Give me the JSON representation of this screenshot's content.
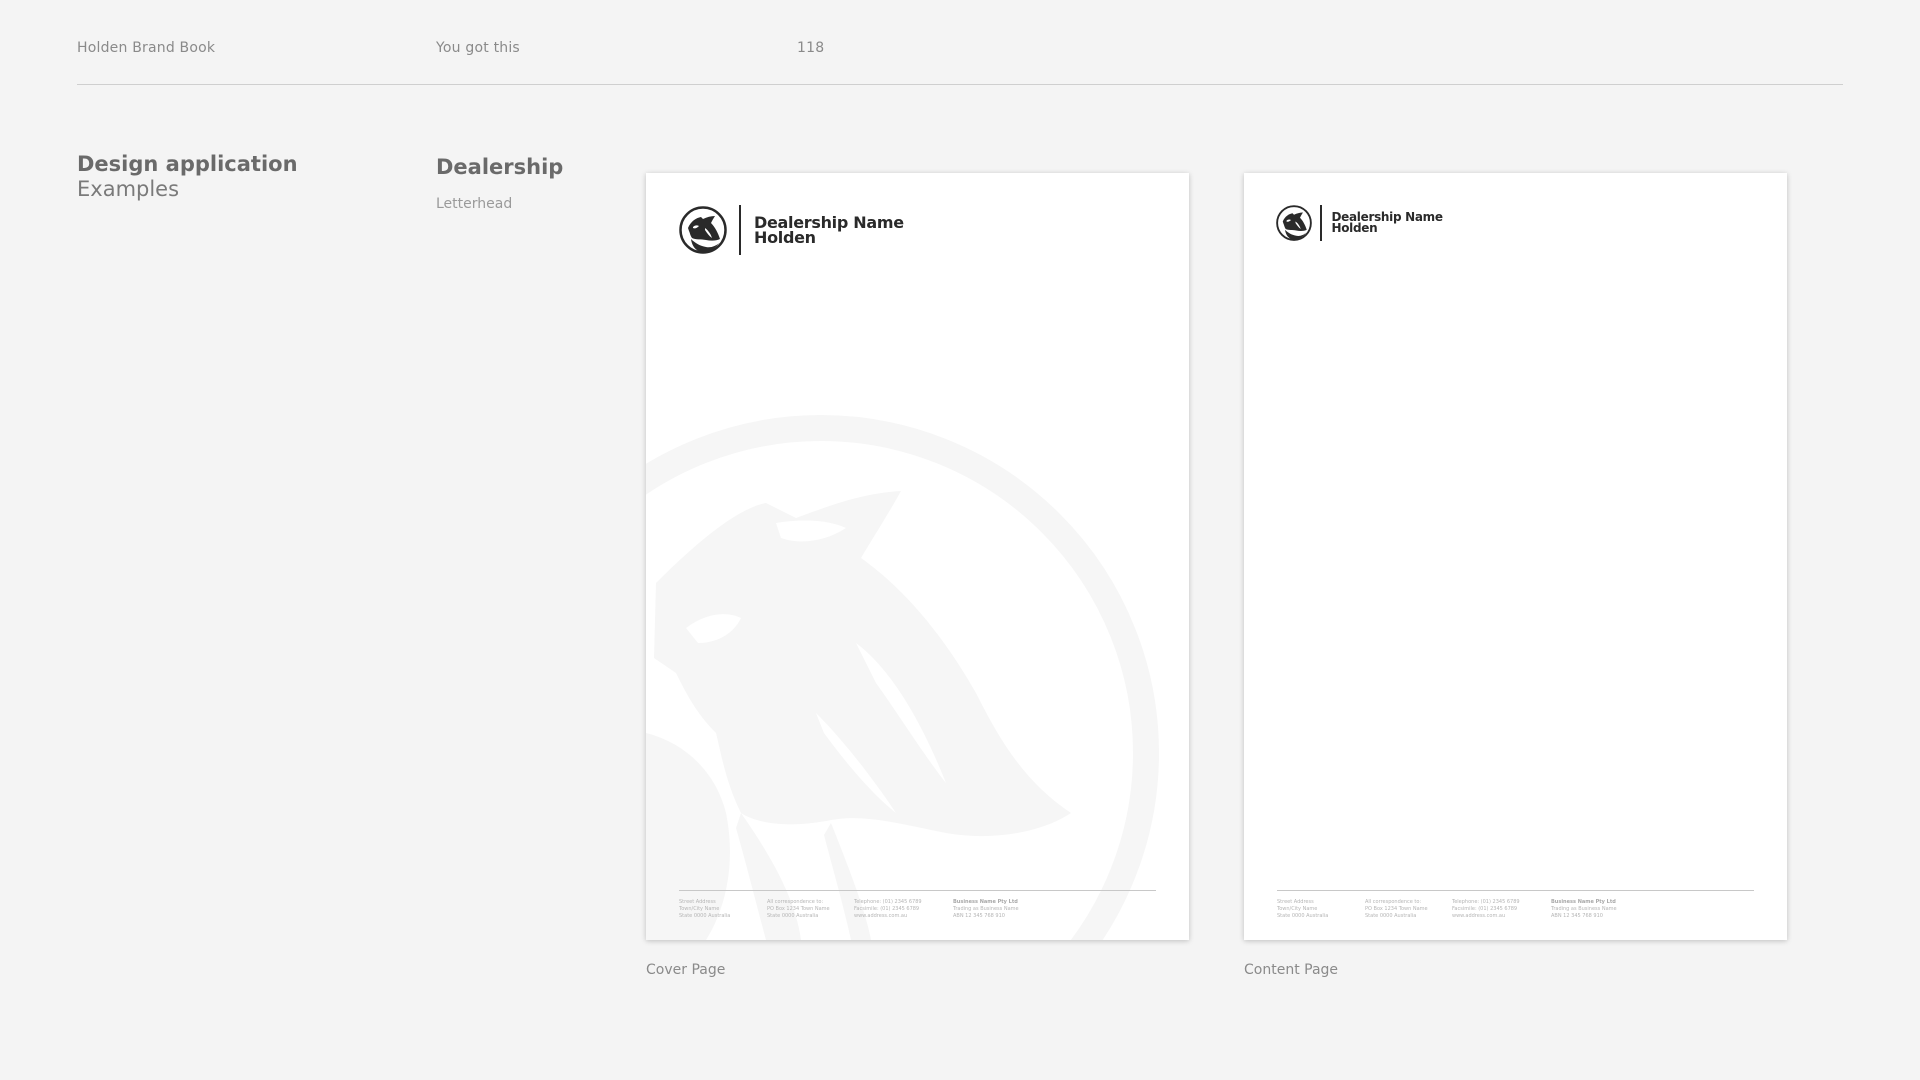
{
  "header": {
    "book_title": "Holden Brand Book",
    "tagline": "You got this",
    "page_number": "118"
  },
  "section": {
    "title": "Design application",
    "subtitle": "Examples"
  },
  "category": {
    "title": "Dealership",
    "subtitle": "Letterhead"
  },
  "letterhead": {
    "name_line1": "Dealership Name",
    "name_line2": "Holden",
    "footer": {
      "address": [
        "Street Address",
        "Town/City Name",
        "State 0000 Australia"
      ],
      "correspondence": [
        "All correspondence to:",
        "PO Box 1234 Town Name",
        "State 0000 Australia"
      ],
      "contact": [
        "Telephone: (01) 2345 6789",
        "Facsimile: (01) 2345 6789",
        "www.address.com.au"
      ],
      "business": [
        "Business Name Pty Ltd",
        "Trading as Business Name",
        "ABN 12 345 768 910"
      ]
    }
  },
  "captions": {
    "cover": "Cover Page",
    "content": "Content Page"
  },
  "colors": {
    "background": "#f4f4f4",
    "page": "#ffffff",
    "logo": "#2a2a2a",
    "watermark": "#f6f6f6"
  }
}
